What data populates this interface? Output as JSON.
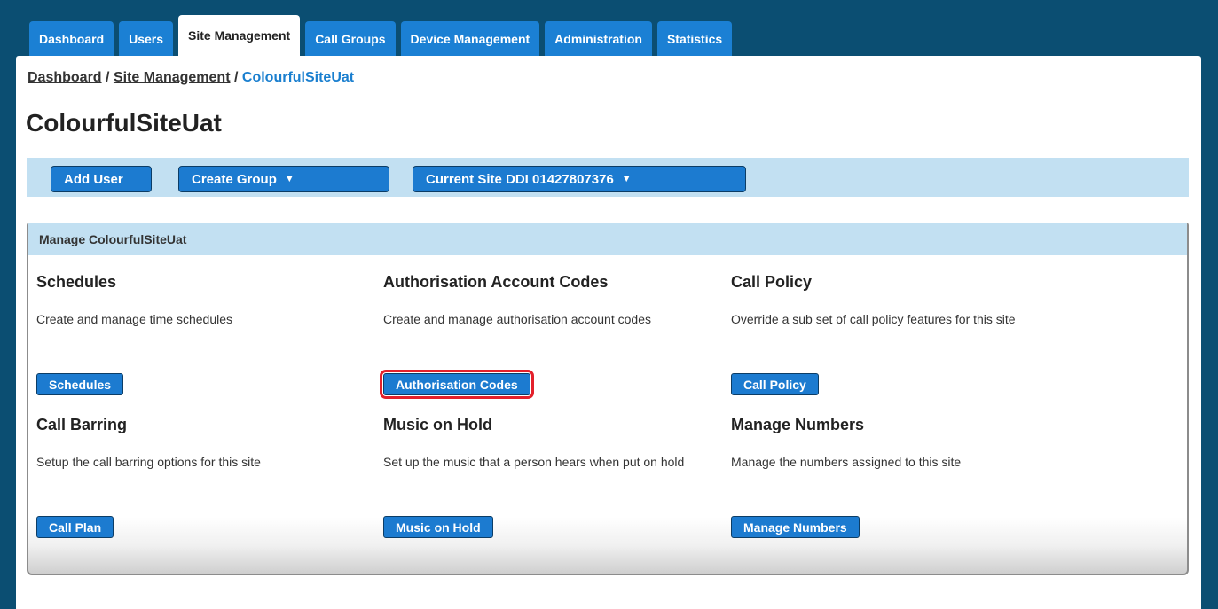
{
  "nav": {
    "tabs": [
      {
        "label": "Dashboard"
      },
      {
        "label": "Users"
      },
      {
        "label": "Site Management"
      },
      {
        "label": "Call Groups"
      },
      {
        "label": "Device Management"
      },
      {
        "label": "Administration"
      },
      {
        "label": "Statistics"
      }
    ],
    "active_tab": "Site Management"
  },
  "breadcrumb": {
    "items": [
      "Dashboard",
      "Site Management"
    ],
    "separator": "/",
    "current": "ColourfulSiteUat"
  },
  "page": {
    "title": "ColourfulSiteUat"
  },
  "toolbar": {
    "add_user": "Add User",
    "create_group": "Create Group",
    "current_site_ddi": "Current Site DDI 01427807376"
  },
  "manage": {
    "header": "Manage ColourfulSiteUat",
    "features": [
      {
        "title": "Schedules",
        "description": "Create and manage time schedules",
        "button": "Schedules"
      },
      {
        "title": "Authorisation Account Codes",
        "description": "Create and manage authorisation account codes",
        "button": "Authorisation Codes"
      },
      {
        "title": "Call Policy",
        "description": "Override a sub set of call policy features for this site",
        "button": "Call Policy"
      },
      {
        "title": "Call Barring",
        "description": "Setup the call barring options for this site",
        "button": "Call Plan"
      },
      {
        "title": "Music on Hold",
        "description": "Set up the music that a person hears when put on hold",
        "button": "Music on Hold"
      },
      {
        "title": "Manage Numbers",
        "description": "Manage the numbers assigned to this site",
        "button": "Manage Numbers"
      }
    ]
  },
  "colors": {
    "page_bg": "#0b4e72",
    "tab_bg": "#1b80d4",
    "button_bg": "#1c7bd0",
    "light_bar_bg": "#c2e0f2",
    "highlight_outline": "#e3202b"
  }
}
